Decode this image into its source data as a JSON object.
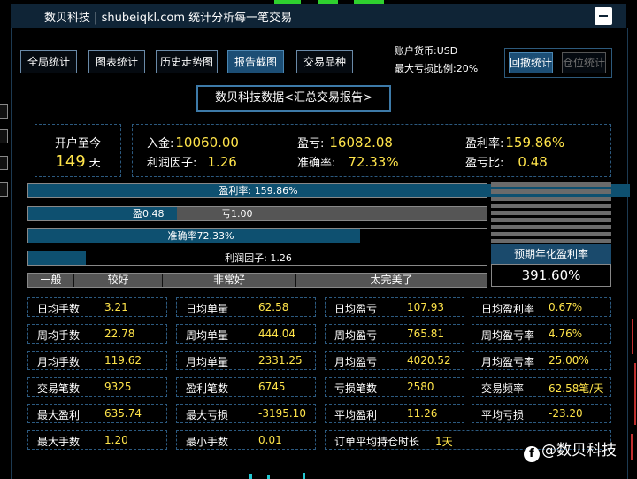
{
  "window": {
    "title": "数贝科技 | shubeiqkl.com 统计分析每一笔交易"
  },
  "toolbar": {
    "tabs": [
      {
        "label": "全局统计"
      },
      {
        "label": "图表统计"
      },
      {
        "label": "历史走势图"
      },
      {
        "label": "报告截图",
        "active": true
      },
      {
        "label": "交易品种"
      }
    ],
    "account_currency": "账户货币:USD",
    "max_drawdown_ratio": "最大亏损比例:20%",
    "right_buttons": [
      {
        "label": "回撤统计",
        "active": true
      },
      {
        "label": "仓位统计",
        "disabled": true
      }
    ]
  },
  "report": {
    "title": "数贝科技数据<汇总交易报告>"
  },
  "summary": {
    "days_label": "开户至今",
    "days_value": "149",
    "days_unit": "天",
    "deposit_label": "入金:",
    "deposit_value": "10060.00",
    "profit_label": "盈亏:",
    "profit_value": "16082.08",
    "profit_rate_label": "盈利率:",
    "profit_rate_value": "159.86%",
    "profit_factor_label": "利润因子:",
    "profit_factor_value": "1.26",
    "accuracy_label": "准确率:",
    "accuracy_value": "72.33%",
    "pl_ratio_label": "盈亏比:",
    "pl_ratio_value": "0.48"
  },
  "bars": {
    "profit_rate": {
      "label": "盈利率: 159.86%",
      "fill": 1.0
    },
    "win_loss": {
      "win_label": "盈0.48",
      "loss_label": "亏1.00",
      "win_fraction": 0.324
    },
    "accuracy": {
      "label": "准确率72.33%",
      "fill": 0.7233
    },
    "profit_factor": {
      "label": "利润因子: 1.26",
      "fill": 0.126
    },
    "scale": [
      "一般",
      "较好",
      "非常好",
      "太完美了"
    ]
  },
  "projection": {
    "label": "预期年化盈利率",
    "value": "391.60%"
  },
  "stats": [
    [
      {
        "k": "日均手数",
        "v": "3.21"
      },
      {
        "k": "日均单量",
        "v": "62.58"
      },
      {
        "k": "日均盈亏",
        "v": "107.93"
      },
      {
        "k": "日均盈利率",
        "v": "0.67%"
      }
    ],
    [
      {
        "k": "周均手数",
        "v": "22.78"
      },
      {
        "k": "周均单量",
        "v": "444.04"
      },
      {
        "k": "周均盈亏",
        "v": "765.81"
      },
      {
        "k": "周均盈亏率",
        "v": "4.76%"
      }
    ],
    [
      {
        "k": "月均手数",
        "v": "119.62"
      },
      {
        "k": "月均单量",
        "v": "2331.25"
      },
      {
        "k": "月均盈亏",
        "v": "4020.52"
      },
      {
        "k": "月均盈亏率",
        "v": "25.00%"
      }
    ],
    [
      {
        "k": "交易笔数",
        "v": "9325"
      },
      {
        "k": "盈利笔数",
        "v": "6745"
      },
      {
        "k": "亏损笔数",
        "v": "2580"
      },
      {
        "k": "交易频率",
        "v": "62.58笔/天"
      }
    ],
    [
      {
        "k": "最大盈利",
        "v": "635.74"
      },
      {
        "k": "最大亏损",
        "v": "-3195.10"
      },
      {
        "k": "平均盈利",
        "v": "11.26"
      },
      {
        "k": "平均亏损",
        "v": "-23.20"
      }
    ]
  ],
  "last_row": {
    "max_lots_label": "最大手数",
    "max_lots_value": "1.20",
    "min_lots_label": "最小手数",
    "min_lots_value": "0.01",
    "avg_hold_label": "订单平均持仓时长",
    "avg_hold_value": "1天"
  },
  "watermark": {
    "text": "@数贝科技",
    "icon": "weibo-logo-icon"
  },
  "colors": {
    "accent": "#1c4e75",
    "value": "#ffe44a",
    "border": "#2c5a80"
  }
}
